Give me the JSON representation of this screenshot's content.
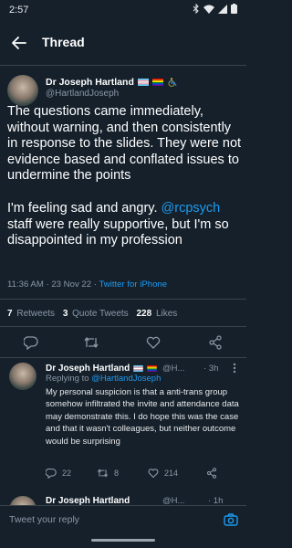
{
  "status_bar": {
    "time": "2:57",
    "icons": [
      "bluetooth-icon",
      "wifi-icon",
      "signal-icon",
      "battery-icon"
    ]
  },
  "app_bar": {
    "back_icon": "arrow-left-icon",
    "title": "Thread"
  },
  "main_tweet": {
    "author_name": "Dr Joseph Hartland",
    "author_handle": "@HartlandJoseph",
    "name_emojis": [
      "trans-flag",
      "pride-flag",
      "wheelchair-emoji"
    ],
    "text_paragraph_1": "The questions came immediately, without warning, and then consistently in response to the slides. They were not evidence based and conflated issues to undermine the points",
    "text_paragraph_2_start": "I'm feeling sad and angry.",
    "text_mention": "@rcpsych",
    "text_paragraph_2_end": "staff were really supportive, but I'm so disappointed in my profession",
    "timestamp": "11:36 AM · 23 Nov 22 ·",
    "client": "Twitter for iPhone"
  },
  "stats": {
    "retweets_count": "7",
    "retweets_label": "Retweets",
    "quotes_count": "3",
    "quotes_label": "Quote Tweets",
    "likes_count": "228",
    "likes_label": "Likes"
  },
  "actions": [
    "reply-icon",
    "retweet-icon",
    "like-icon",
    "share-icon"
  ],
  "reply_tweet": {
    "author_name": "Dr Joseph Hartland",
    "author_handle": "@H...",
    "time": "· 3h",
    "replying_to_label": "Replying to",
    "replying_to_handle": "@HartlandJoseph",
    "text": "My personal suspicion is that a anti-trans group somehow infiltrated the invite and attendance data may demonstrate this. I do hope this was the case and that it wasn't colleagues, but neither outcome would be surprising",
    "reply_count": "22",
    "retweet_count": "8",
    "like_count": "214"
  },
  "next_reply": {
    "author_name": "Dr Joseph Hartland",
    "author_handle": "@H...",
    "time": "· 1h"
  },
  "composer": {
    "placeholder": "Tweet your reply",
    "camera_icon": "camera-icon"
  },
  "colors": {
    "background": "#15202b",
    "accent": "#1d9bf0",
    "secondary_text": "#8b98a5",
    "divider": "#38444d"
  }
}
